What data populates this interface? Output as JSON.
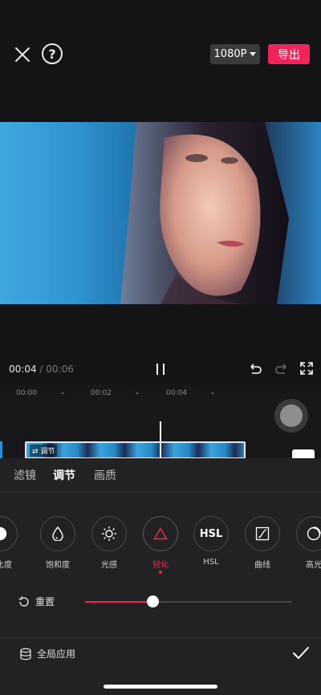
{
  "header": {
    "resolution": "1080P",
    "export_label": "导出"
  },
  "playback": {
    "current_time": "00:04",
    "separator": "/",
    "total_time": "00:06"
  },
  "timeline": {
    "ticks": [
      "00:00",
      "00:02",
      "00:04"
    ],
    "track_label": "调节"
  },
  "tabs": [
    {
      "label": "滤镜"
    },
    {
      "label": "调节"
    },
    {
      "label": "画质"
    }
  ],
  "tools": [
    {
      "label": "对比度",
      "icon": "contrast-icon"
    },
    {
      "label": "饱和度",
      "icon": "droplet-icon"
    },
    {
      "label": "光感",
      "icon": "light-icon"
    },
    {
      "label": "锐化",
      "icon": "triangle-icon"
    },
    {
      "label": "HSL",
      "icon": "hsl-icon"
    },
    {
      "label": "曲线",
      "icon": "curve-icon"
    },
    {
      "label": "高光",
      "icon": "highlight-icon"
    }
  ],
  "adjust": {
    "reset_label": "重置",
    "slider_value": 0.33
  },
  "footer": {
    "apply_label": "全局应用"
  },
  "colors": {
    "accent": "#f0245a",
    "panel": "#222225"
  }
}
